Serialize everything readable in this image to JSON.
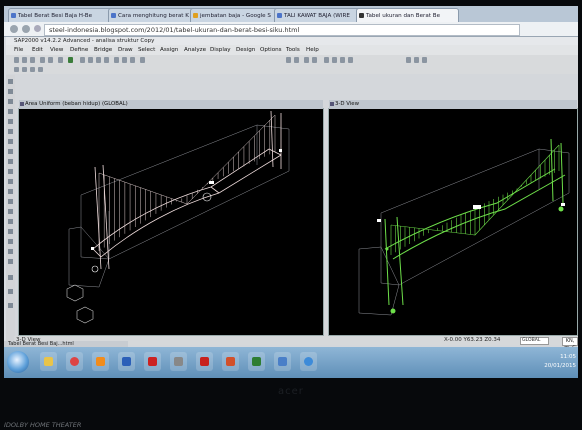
{
  "browser": {
    "tabs": [
      {
        "label": "Tabel Berat Besi Baja H-Be"
      },
      {
        "label": "Cara menghitung berat K"
      },
      {
        "label": "jembatan baja - Google S"
      },
      {
        "label": "TALI KAWAT BAJA (WIRE"
      },
      {
        "label": "Tabel ukuran dan Berat Be",
        "active": true
      }
    ],
    "url": "steel-indonesia.blogspot.com/2012/01/tabel-ukuran-dan-berat-besi-siku.html"
  },
  "sap": {
    "title": "SAP2000 v14.2.2 Advanced  -  analisa struktur  Copy",
    "menus": [
      "File",
      "Edit",
      "View",
      "Define",
      "Bridge",
      "Draw",
      "Select",
      "Assign",
      "Analyze",
      "Display",
      "Design",
      "Options",
      "Tools",
      "Help"
    ],
    "left_view_title": "Area Uniform (beban hidup) (GLOBAL)",
    "right_view_title": "3-D View",
    "status_left": "3-D View",
    "status_coords": "X-0.00  Y63.23  Z0.34",
    "status_units": "KN, m, C",
    "dropdown1": "GLOBAL",
    "dropdown2": "KN, m, C"
  },
  "taskbar": {
    "preview_label": "Tabel Berat Besi Baj...html",
    "time": "11:05",
    "date": "20/01/2015"
  },
  "monitor": {
    "brand": "acer",
    "watermark": "IDOLBY HOME THEATER"
  },
  "colors": {
    "left_structure": "#f1dede",
    "right_structure": "#6ee04a",
    "viewport_bg": "#000000",
    "taskbar": "#5f8fb8"
  }
}
